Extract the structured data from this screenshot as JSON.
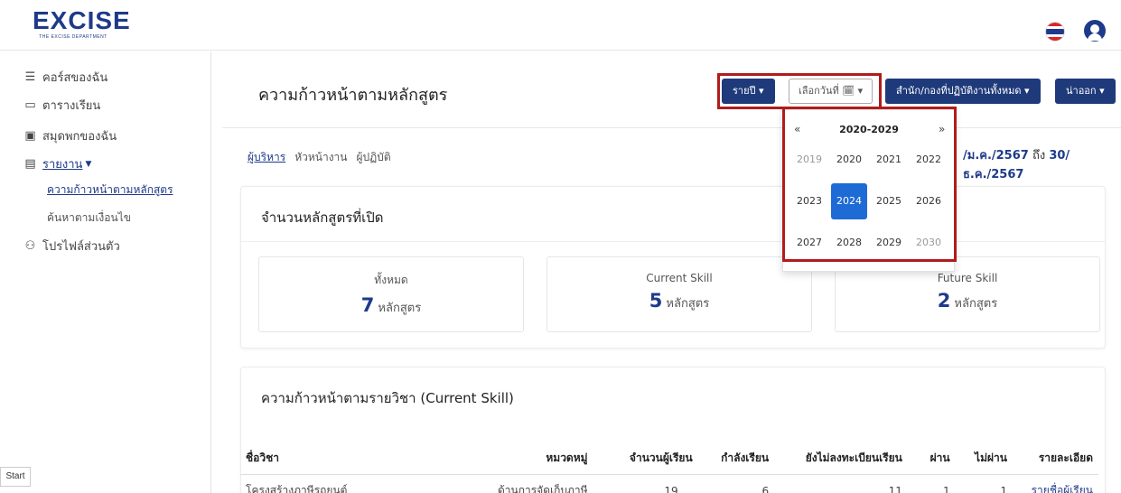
{
  "header": {
    "logo_text": "EXCISE",
    "logo_subtext": "THE EXCISE DEPARTMENT"
  },
  "sidebar": {
    "items": [
      {
        "label": "คอร์สของฉัน"
      },
      {
        "label": "ตารางเรียน"
      },
      {
        "label": "สมุดพกของฉัน"
      },
      {
        "label": "รายงาน"
      },
      {
        "label": "โปรไฟล์ส่วนตัว"
      }
    ],
    "subitems": [
      {
        "label": "ความก้าวหน้าตามหลักสูตร"
      },
      {
        "label": "ค้นหาตามเงื่อนไข"
      }
    ],
    "start_label": "Start"
  },
  "main": {
    "title": "ความก้าวหน้าตามหลักสูตร",
    "buttons": {
      "period": "รายปี ▾",
      "choose_date": "เลือกวันที่ 🗓 ▾",
      "office": "สำนัก/กองที่ปฏิบัติงานทั้งหมด ▾",
      "province": "น่าออก ▾"
    },
    "tabs": [
      "ผู้บริหาร",
      "หัวหน้างาน",
      "ผู้ปฏิบัติ"
    ],
    "date_range": {
      "from": "/ม.ค./2567",
      "to_word": "ถึง",
      "to": "30/ธ.ค./2567"
    },
    "open_courses": {
      "title": "จำนวนหลักสูตรที่เปิด",
      "unit": "หลักสูตร",
      "stats": [
        {
          "label": "ทั้งหมด",
          "value": "7"
        },
        {
          "label": "Current Skill",
          "value": "5"
        },
        {
          "label": "Future Skill",
          "value": "2"
        }
      ]
    },
    "subject_progress": {
      "title": "ความก้าวหน้าตามรายวิชา (Current Skill)",
      "columns": [
        "ชื่อวิชา",
        "หมวดหมู่",
        "จำนวนผู้เรียน",
        "กำลังเรียน",
        "ยังไม่ลงทะเบียนเรียน",
        "ผ่าน",
        "ไม่ผ่าน",
        "รายละเอียด"
      ],
      "rows": [
        [
          "โครงสร้างภาษีรถยนต์",
          "ด้านการจัดเก็บภาษี",
          "19",
          "6",
          "11",
          "1",
          "1",
          "รายชื่อผู้เรียน"
        ]
      ]
    }
  },
  "year_picker": {
    "prev": "«",
    "next": "»",
    "decade": "2020-2029",
    "years": [
      "2019",
      "2020",
      "2021",
      "2022",
      "2023",
      "2024",
      "2025",
      "2026",
      "2027",
      "2028",
      "2029",
      "2030"
    ],
    "selected": "2024"
  },
  "colors": {
    "primary": "#1f3a7a",
    "highlight_box": "#b01c1c",
    "selected_year": "#1e6bd6"
  }
}
